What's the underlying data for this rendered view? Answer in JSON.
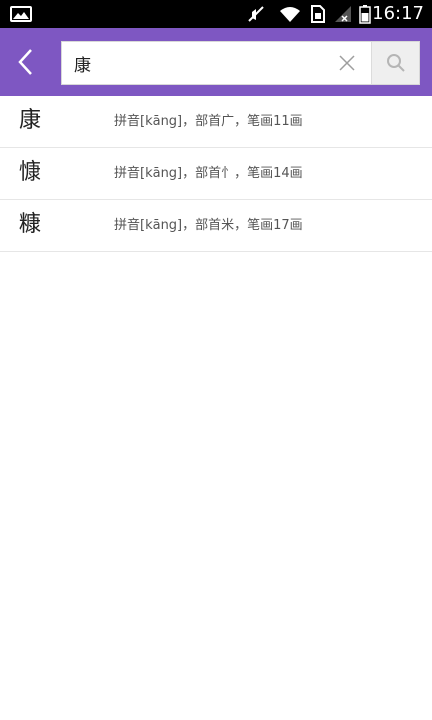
{
  "status_bar": {
    "time": "16:17",
    "icons": [
      "image-icon",
      "mute-icon",
      "wifi-icon",
      "sim-icon",
      "signal-off-icon",
      "battery-icon"
    ]
  },
  "header": {
    "back_icon": "chevron-left-icon",
    "search": {
      "value": "康"
    },
    "clear_icon": "close-icon",
    "search_icon": "search-icon",
    "colors": {
      "bar": "#7e57c2"
    }
  },
  "results": [
    {
      "char": "康",
      "desc": "拼音[kāng]，部首广，笔画11画"
    },
    {
      "char": "慷",
      "desc": "拼音[kāng]，部首忄，笔画14画"
    },
    {
      "char": "糠",
      "desc": "拼音[kāng]，部首米，笔画17画"
    }
  ]
}
